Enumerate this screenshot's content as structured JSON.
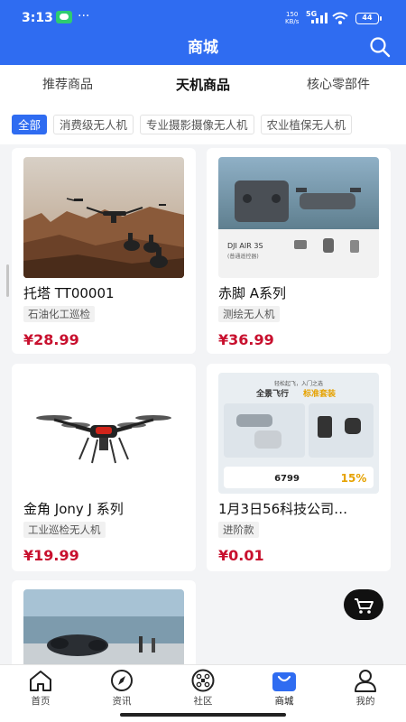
{
  "status_bar": {
    "time": "3:13",
    "more": "···",
    "speed_top": "150",
    "speed_bottom": "KB/s",
    "network": "5G",
    "battery": "44"
  },
  "header": {
    "title": "商城"
  },
  "tabs": [
    {
      "label": "推荐商品",
      "active": false
    },
    {
      "label": "天机商品",
      "active": true
    },
    {
      "label": "核心零部件",
      "active": false
    }
  ],
  "chips": [
    {
      "label": "全部",
      "active": true
    },
    {
      "label": "消费级无人机",
      "active": false
    },
    {
      "label": "专业摄影摄像无人机",
      "active": false
    },
    {
      "label": "农业植保无人机",
      "active": false
    }
  ],
  "products": [
    {
      "name": "托塔 TT00001",
      "tag": "石油化工巡检",
      "price": "¥28.99"
    },
    {
      "name": "赤脚 A系列",
      "tag": "测绘无人机",
      "price": "¥36.99",
      "image_text": {
        "model": "DJI AIR 3S",
        "sub": "(普通遥控器)",
        "box": "带屏遥控器 RC 2"
      }
    },
    {
      "name": "金角 Jony J 系列",
      "tag": "工业巡检无人机",
      "price": "¥19.99"
    },
    {
      "name": "1月3日56科技公司宣传",
      "display_name": "1月3日56科技公司…",
      "tag": "进阶款",
      "price": "¥0.01",
      "image_text": {
        "line1": "轻松起飞，入门之选",
        "line2a": "全景飞行",
        "line2b": "标准套装",
        "price": "6799",
        "discount": "15%"
      }
    },
    {
      "name": "",
      "tag": "",
      "price": ""
    }
  ],
  "bottom_nav": [
    {
      "label": "首页",
      "icon": "home-icon",
      "active": false
    },
    {
      "label": "资讯",
      "icon": "compass-icon",
      "active": false
    },
    {
      "label": "社区",
      "icon": "community-icon",
      "active": false
    },
    {
      "label": "商城",
      "icon": "shop-bag-icon",
      "active": true
    },
    {
      "label": "我的",
      "icon": "profile-icon",
      "active": false
    }
  ],
  "colors": {
    "primary": "#2f6cf1",
    "price": "#c8102e",
    "background": "#f3f4f6"
  }
}
